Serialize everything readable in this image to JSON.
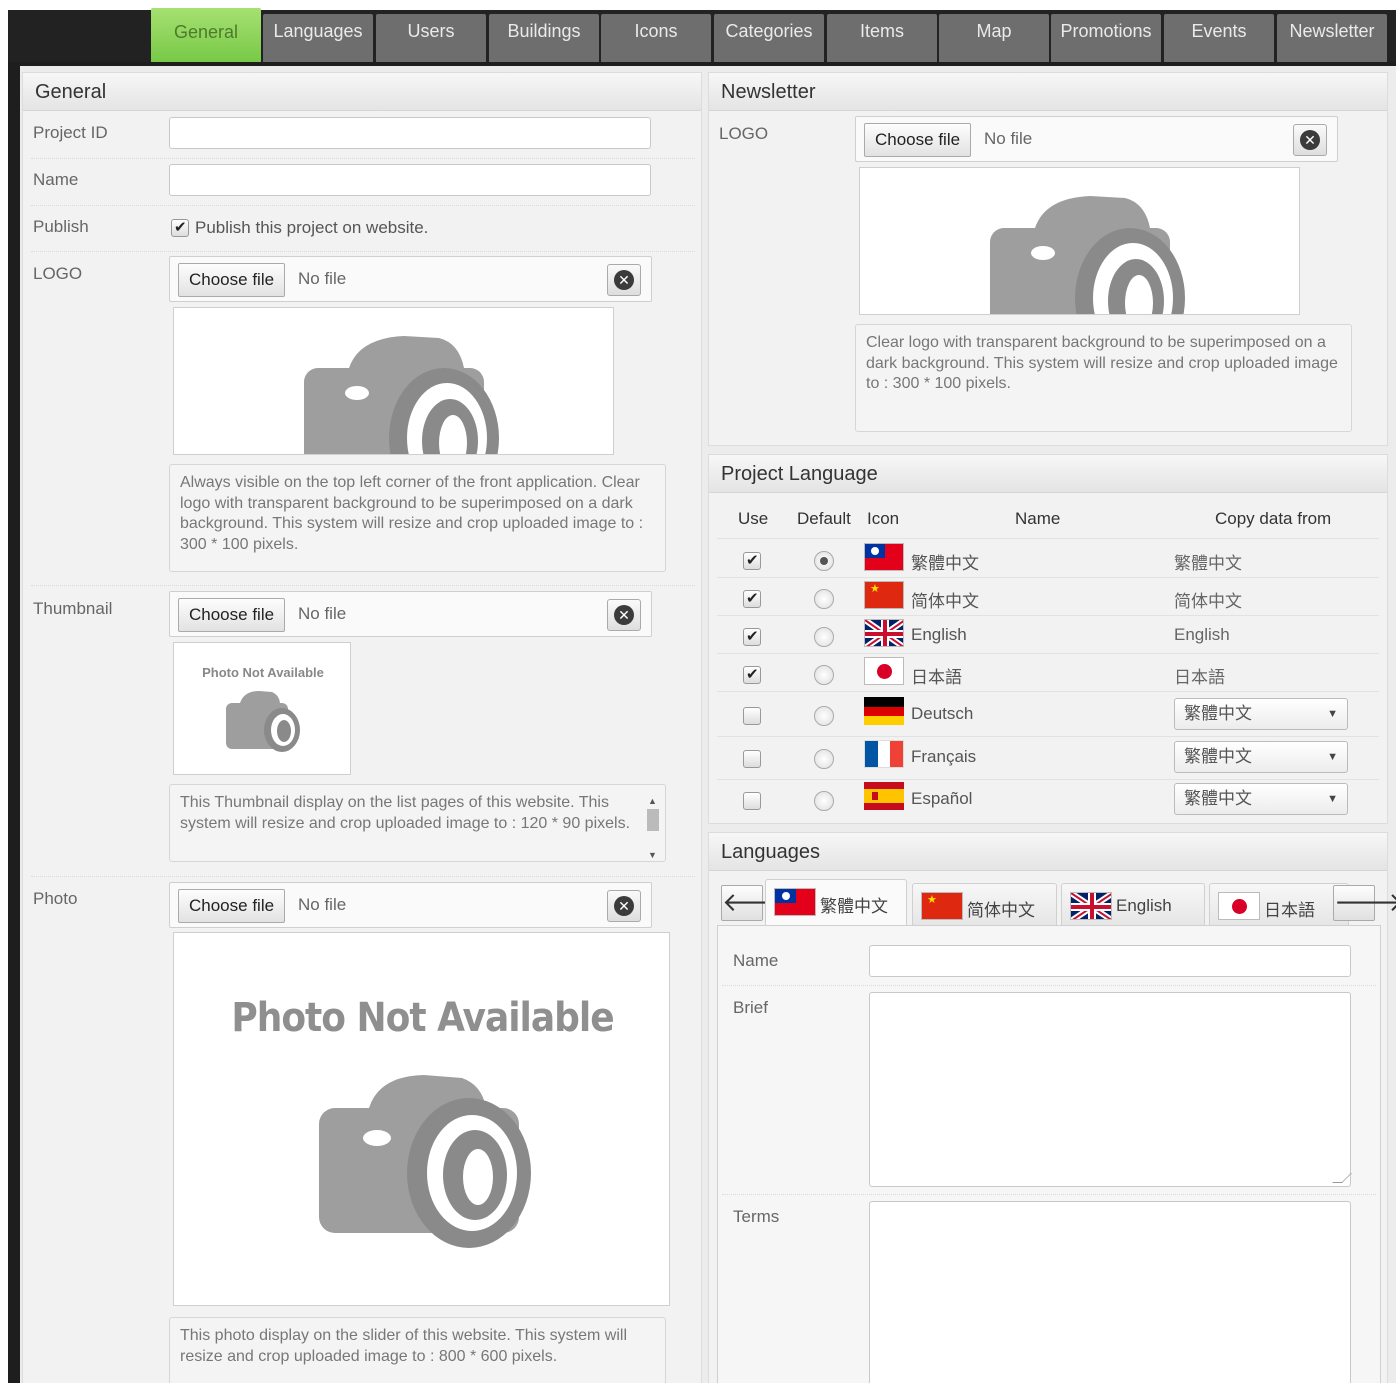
{
  "nav_tabs": [
    "General",
    "Languages",
    "Users",
    "Buildings",
    "Icons",
    "Categories",
    "Items",
    "Map",
    "Promotions",
    "Events",
    "Newsletter"
  ],
  "general": {
    "title": "General",
    "project_id_label": "Project ID",
    "project_id_value": "",
    "name_label": "Name",
    "name_value": "",
    "publish_label": "Publish",
    "publish_checked": true,
    "publish_text": "Publish this project on website.",
    "logo_label": "LOGO",
    "logo_help": "Always visible on the top left corner of the front application. Clear logo with transparent background to be superimposed on a dark background. This system will resize and crop uploaded image to : 300 * 100 pixels.",
    "thumbnail_label": "Thumbnail",
    "thumbnail_placeholder_text": "Photo Not Available",
    "thumbnail_help": "This Thumbnail display on the list pages of this website. This system will resize and crop uploaded image to : 120 * 90 pixels.",
    "photo_label": "Photo",
    "photo_placeholder_text": "Photo Not Available",
    "photo_help": "This photo display on the slider of this website. This system will resize and crop uploaded image to : 800 * 600 pixels."
  },
  "file_input": {
    "choose_label": "Choose file",
    "no_file_label": "No file"
  },
  "newsletter": {
    "title": "Newsletter",
    "logo_label": "LOGO",
    "logo_help": "Clear logo with transparent background to be superimposed on a dark background. This system will resize and crop uploaded image to : 300 * 100 pixels."
  },
  "project_language": {
    "title": "Project Language",
    "headers": {
      "use": "Use",
      "default": "Default",
      "icon": "Icon",
      "name": "Name",
      "copy": "Copy data from"
    },
    "rows": [
      {
        "use": true,
        "default": true,
        "flag": "taiwan-flag-icon",
        "name": "繁體中文",
        "copy": "繁體中文",
        "copy_is_select": false
      },
      {
        "use": true,
        "default": false,
        "flag": "china-flag-icon",
        "name": "简体中文",
        "copy": "简体中文",
        "copy_is_select": false
      },
      {
        "use": true,
        "default": false,
        "flag": "uk-flag-icon",
        "name": "English",
        "copy": "English",
        "copy_is_select": false
      },
      {
        "use": true,
        "default": false,
        "flag": "japan-flag-icon",
        "name": "日本語",
        "copy": "日本語",
        "copy_is_select": false
      },
      {
        "use": false,
        "default": false,
        "flag": "germany-flag-icon",
        "name": "Deutsch",
        "copy": "繁體中文",
        "copy_is_select": true
      },
      {
        "use": false,
        "default": false,
        "flag": "france-flag-icon",
        "name": "Français",
        "copy": "繁體中文",
        "copy_is_select": true
      },
      {
        "use": false,
        "default": false,
        "flag": "spain-flag-icon",
        "name": "Español",
        "copy": "繁體中文",
        "copy_is_select": true
      }
    ]
  },
  "languages": {
    "title": "Languages",
    "tabs": [
      {
        "label": "繁體中文",
        "flag": "taiwan-flag-icon"
      },
      {
        "label": "简体中文",
        "flag": "china-flag-icon"
      },
      {
        "label": "English",
        "flag": "uk-flag-icon"
      },
      {
        "label": "日本語",
        "flag": "japan-flag-icon"
      }
    ],
    "name_label": "Name",
    "name_value": "",
    "brief_label": "Brief",
    "brief_value": "",
    "terms_label": "Terms",
    "terms_value": ""
  },
  "colors": {
    "active_tab": "#8bd35a",
    "tab_bg": "#6e6e6e",
    "topbar": "#222222"
  }
}
